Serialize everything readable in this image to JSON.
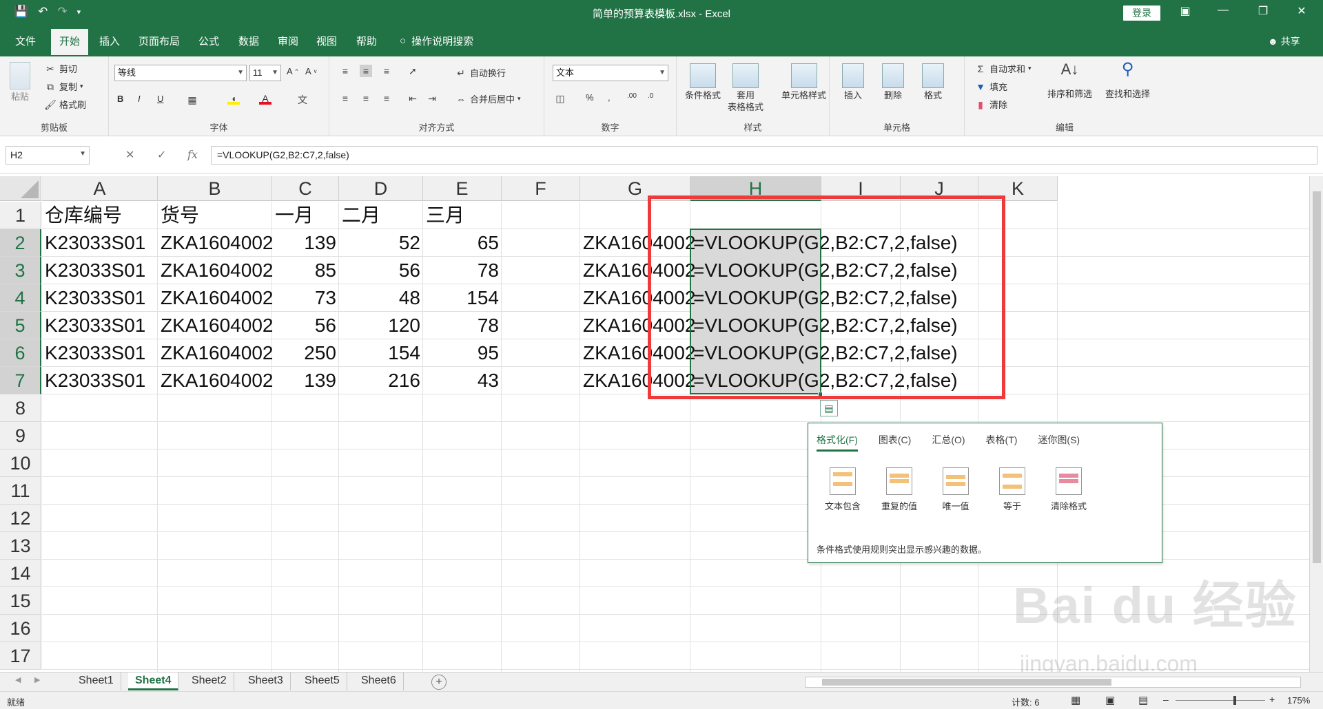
{
  "window": {
    "title": "简单的预算表模板.xlsx  -  Excel",
    "login_label": "登录",
    "share_label": "共享"
  },
  "tabs": [
    {
      "label": "文件"
    },
    {
      "label": "开始"
    },
    {
      "label": "插入"
    },
    {
      "label": "页面布局"
    },
    {
      "label": "公式"
    },
    {
      "label": "数据"
    },
    {
      "label": "审阅"
    },
    {
      "label": "视图"
    },
    {
      "label": "帮助"
    }
  ],
  "tell_me": "操作说明搜索",
  "ribbon": {
    "clipboard": {
      "label": "剪贴板",
      "paste": "粘贴",
      "cut": "剪切",
      "copy": "复制",
      "painter": "格式刷"
    },
    "font": {
      "label": "字体",
      "name": "等线",
      "size": "11"
    },
    "alignment": {
      "label": "对齐方式",
      "wrap": "自动换行",
      "merge": "合并后居中"
    },
    "number": {
      "label": "数字",
      "format": "文本"
    },
    "styles": {
      "label": "样式",
      "conditional": "条件格式",
      "table1": "套用",
      "table2": "表格格式",
      "cell_styles": "单元格样式"
    },
    "cells": {
      "label": "单元格",
      "insert": "插入",
      "delete": "删除",
      "format": "格式"
    },
    "editing": {
      "label": "编辑",
      "autosum": "自动求和",
      "fill": "填充",
      "clear": "清除",
      "sort": "排序和筛选",
      "find": "查找和选择"
    }
  },
  "formula_bar": {
    "name_box": "H2",
    "fx": "fx",
    "formula": "=VLOOKUP(G2,B2:C7,2,false)"
  },
  "columns": [
    "A",
    "B",
    "C",
    "D",
    "E",
    "F",
    "G",
    "H",
    "I",
    "J",
    "K"
  ],
  "rows": [
    "1",
    "2",
    "3",
    "4",
    "5",
    "6",
    "7",
    "8",
    "9",
    "10",
    "11",
    "12",
    "13",
    "14",
    "15",
    "16",
    "17"
  ],
  "sheet": {
    "header": [
      "仓库编号",
      "货号",
      "一月",
      "二月",
      "三月"
    ],
    "data": [
      [
        "K23033S01",
        "ZKA1604002",
        "139",
        "52",
        "65",
        "ZKA1604002",
        "=VLOOKUP(G2,B2:C7,2,false)"
      ],
      [
        "K23033S01",
        "ZKA1604002",
        "85",
        "56",
        "78",
        "ZKA1604002",
        "=VLOOKUP(G2,B2:C7,2,false)"
      ],
      [
        "K23033S01",
        "ZKA1604002",
        "73",
        "48",
        "154",
        "ZKA1604002",
        "=VLOOKUP(G2,B2:C7,2,false)"
      ],
      [
        "K23033S01",
        "ZKA1604002",
        "56",
        "120",
        "78",
        "ZKA1604002",
        "=VLOOKUP(G2,B2:C7,2,false)"
      ],
      [
        "K23033S01",
        "ZKA1604002",
        "250",
        "154",
        "95",
        "ZKA1604002",
        "=VLOOKUP(G2,B2:C7,2,false)"
      ],
      [
        "K23033S01",
        "ZKA1604002",
        "139",
        "216",
        "43",
        "ZKA1604002",
        "=VLOOKUP(G2,B2:C7,2,false)"
      ]
    ]
  },
  "quick_analysis": {
    "tabs": [
      "格式化(F)",
      "图表(C)",
      "汇总(O)",
      "表格(T)",
      "迷你图(S)"
    ],
    "items": [
      "文本包含",
      "重复的值",
      "唯一值",
      "等于",
      "清除格式"
    ],
    "description": "条件格式使用规则突出显示感兴趣的数据。"
  },
  "sheet_tabs": [
    "Sheet1",
    "Sheet4",
    "Sheet2",
    "Sheet3",
    "Sheet5",
    "Sheet6"
  ],
  "status": {
    "ready": "就绪",
    "count": "计数: 6",
    "zoom": "175%"
  },
  "watermark": {
    "brand": "Bai du 经验",
    "url": "jingyan.baidu.com"
  },
  "colors": {
    "accent": "#217346",
    "highlight": "#ee3a3a"
  }
}
